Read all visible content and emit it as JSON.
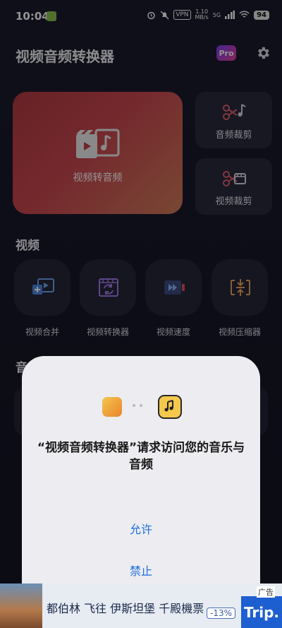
{
  "status_bar": {
    "time": "10:04",
    "vpn": "VPN",
    "net_speed": "1.10",
    "net_unit": "MB/s",
    "signal": "5G",
    "battery": "94"
  },
  "header": {
    "title": "视频音频转换器",
    "pro_label": "Pro"
  },
  "cards": {
    "main": "视频转音频",
    "audio_trim": "音频裁剪",
    "video_trim": "视频裁剪"
  },
  "video_section": {
    "title": "视频",
    "tools": [
      "视频合并",
      "视频转换器",
      "视频速度",
      "视频压缩器"
    ]
  },
  "audio_section": {
    "title": "音"
  },
  "dialog": {
    "message": "“视频音频转换器”请求访问您的音乐与音频",
    "allow": "允许",
    "deny": "禁止"
  },
  "ad": {
    "text": "都伯林 飞往 伊斯坦堡 千殿機票",
    "discount": "-13%",
    "tag": "广告",
    "brand": "Trip."
  },
  "colors": {
    "background": "#171727",
    "main_card": "#c9474f",
    "dialog_bg": "#ececf1",
    "link_blue": "#1f6fe0"
  }
}
